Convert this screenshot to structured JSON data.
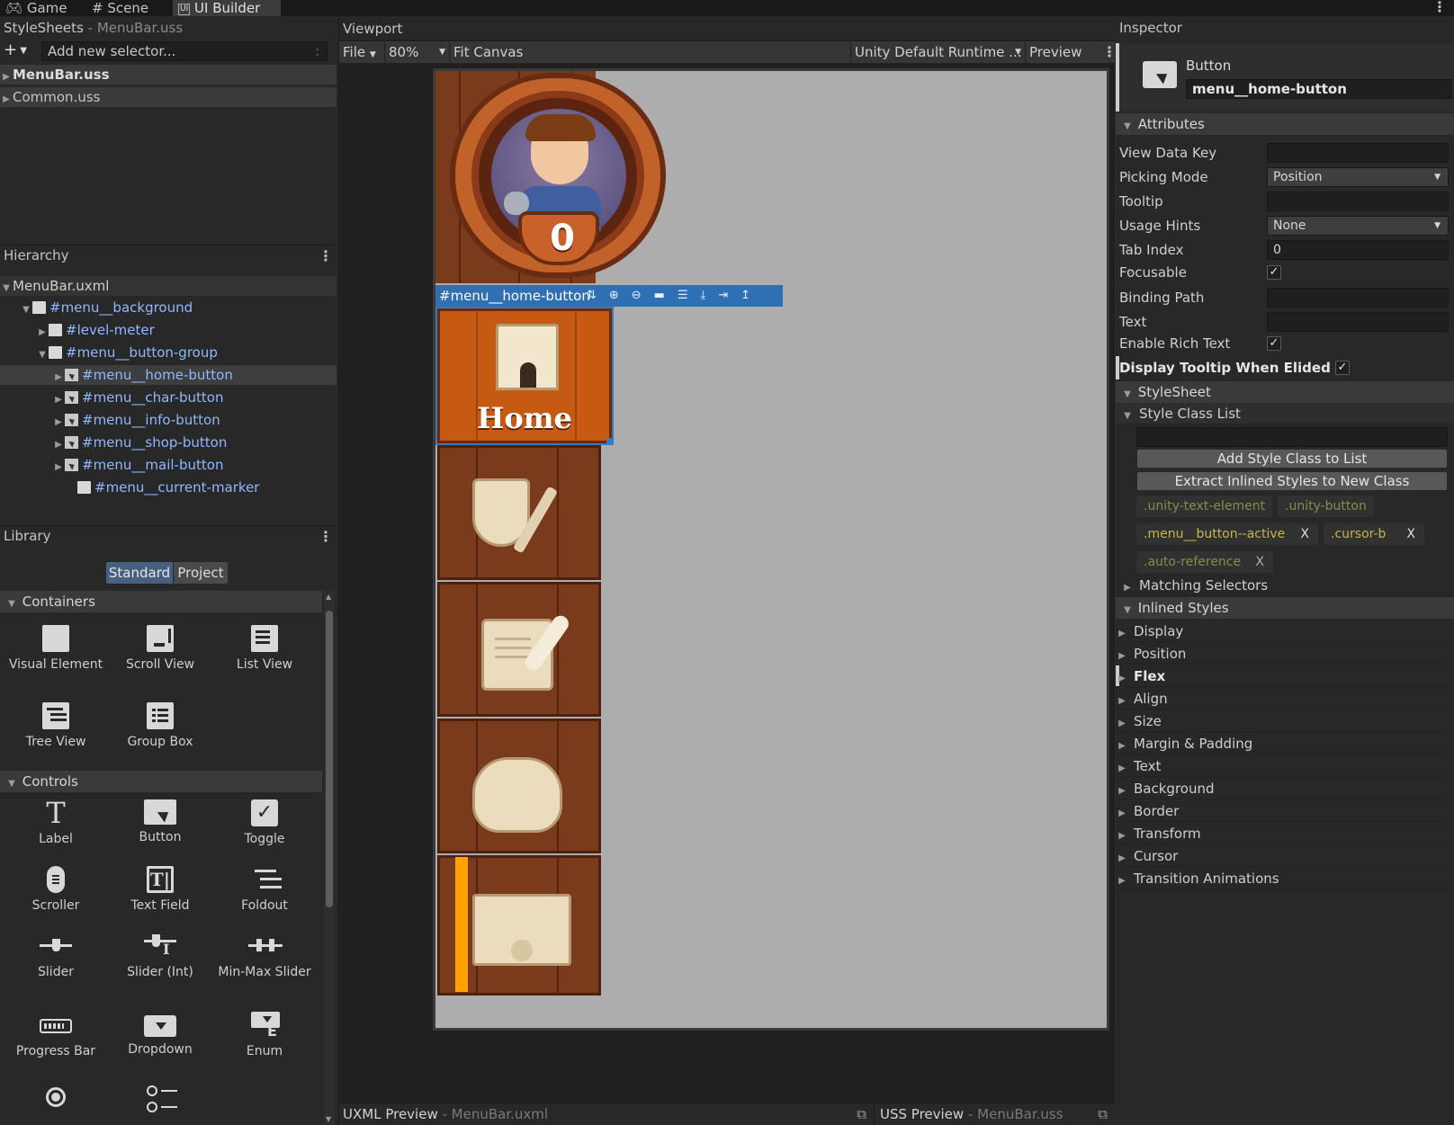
{
  "tabs": [
    {
      "label": "Game",
      "icon": "gamepad-icon"
    },
    {
      "label": "Scene",
      "icon": "grid-icon"
    },
    {
      "label": "UI Builder",
      "icon": "ui-builder-icon"
    }
  ],
  "stylesheets": {
    "title": "StyleSheets",
    "subtitle": "- MenuBar.uss",
    "selector_placeholder": "Add new selector...",
    "items": [
      "MenuBar.uss",
      "Common.uss"
    ]
  },
  "hierarchy": {
    "title": "Hierarchy",
    "root": "MenuBar.uxml",
    "items": [
      "#menu__background",
      "#level-meter",
      "#menu__button-group",
      "#menu__home-button",
      "#menu__char-button",
      "#menu__info-button",
      "#menu__shop-button",
      "#menu__mail-button",
      "#menu__current-marker"
    ]
  },
  "library": {
    "title": "Library",
    "tab_standard": "Standard",
    "tab_project": "Project",
    "sections": [
      "Containers",
      "Controls"
    ],
    "containers": [
      "Visual Element",
      "Scroll View",
      "List View",
      "Tree View",
      "Group Box"
    ],
    "controls": [
      "Label",
      "Button",
      "Toggle",
      "Scroller",
      "Text Field",
      "Foldout",
      "Slider",
      "Slider (Int)",
      "Min-Max Slider",
      "Progress Bar",
      "Dropdown",
      "Enum"
    ]
  },
  "viewport": {
    "title": "Viewport",
    "file": "File",
    "zoom": "80%",
    "fit": "Fit Canvas",
    "theme": "Unity Default Runtime ...",
    "preview": "Preview",
    "selection_label": "#menu__home-button",
    "level": "0",
    "home_label": "Home"
  },
  "bottom": {
    "uxml": "UXML Preview",
    "uxml_file": "- MenuBar.uxml",
    "uss": "USS Preview",
    "uss_file": "- MenuBar.uss"
  },
  "inspector": {
    "title": "Inspector",
    "element_type": "Button",
    "element_name": "menu__home-button",
    "attributes_title": "Attributes",
    "attrs": {
      "view_data_key": "View Data Key",
      "picking_mode": "Picking Mode",
      "picking_mode_value": "Position",
      "tooltip": "Tooltip",
      "usage_hints": "Usage Hints",
      "usage_hints_value": "None",
      "tab_index": "Tab Index",
      "tab_index_value": "0",
      "focusable": "Focusable",
      "binding_path": "Binding Path",
      "text": "Text",
      "enable_rich_text": "Enable Rich Text",
      "display_tooltip": "Display Tooltip When Elided",
      "check": "✓"
    },
    "stylesheet_title": "StyleSheet",
    "style_class_list": "Style Class List",
    "add_class": "Add Style Class to List",
    "extract": "Extract Inlined Styles to New Class",
    "classes": [
      ".unity-text-element",
      ".unity-button",
      ".menu__button--active",
      ".cursor-b",
      ".auto-reference"
    ],
    "remove": "X",
    "matching": "Matching Selectors",
    "inlined": "Inlined Styles",
    "style_sections": [
      "Display",
      "Position",
      "Flex",
      "Align",
      "Size",
      "Margin & Padding",
      "Text",
      "Background",
      "Border",
      "Transform",
      "Cursor",
      "Transition Animations"
    ]
  },
  "colors": {
    "accent": "#3a78b8",
    "class_yellow": "#c8b54a",
    "class_dim": "#8a8a4a",
    "wood": "#7a3a1c",
    "active_tile": "#c65a12",
    "marker": "#ffa200"
  }
}
